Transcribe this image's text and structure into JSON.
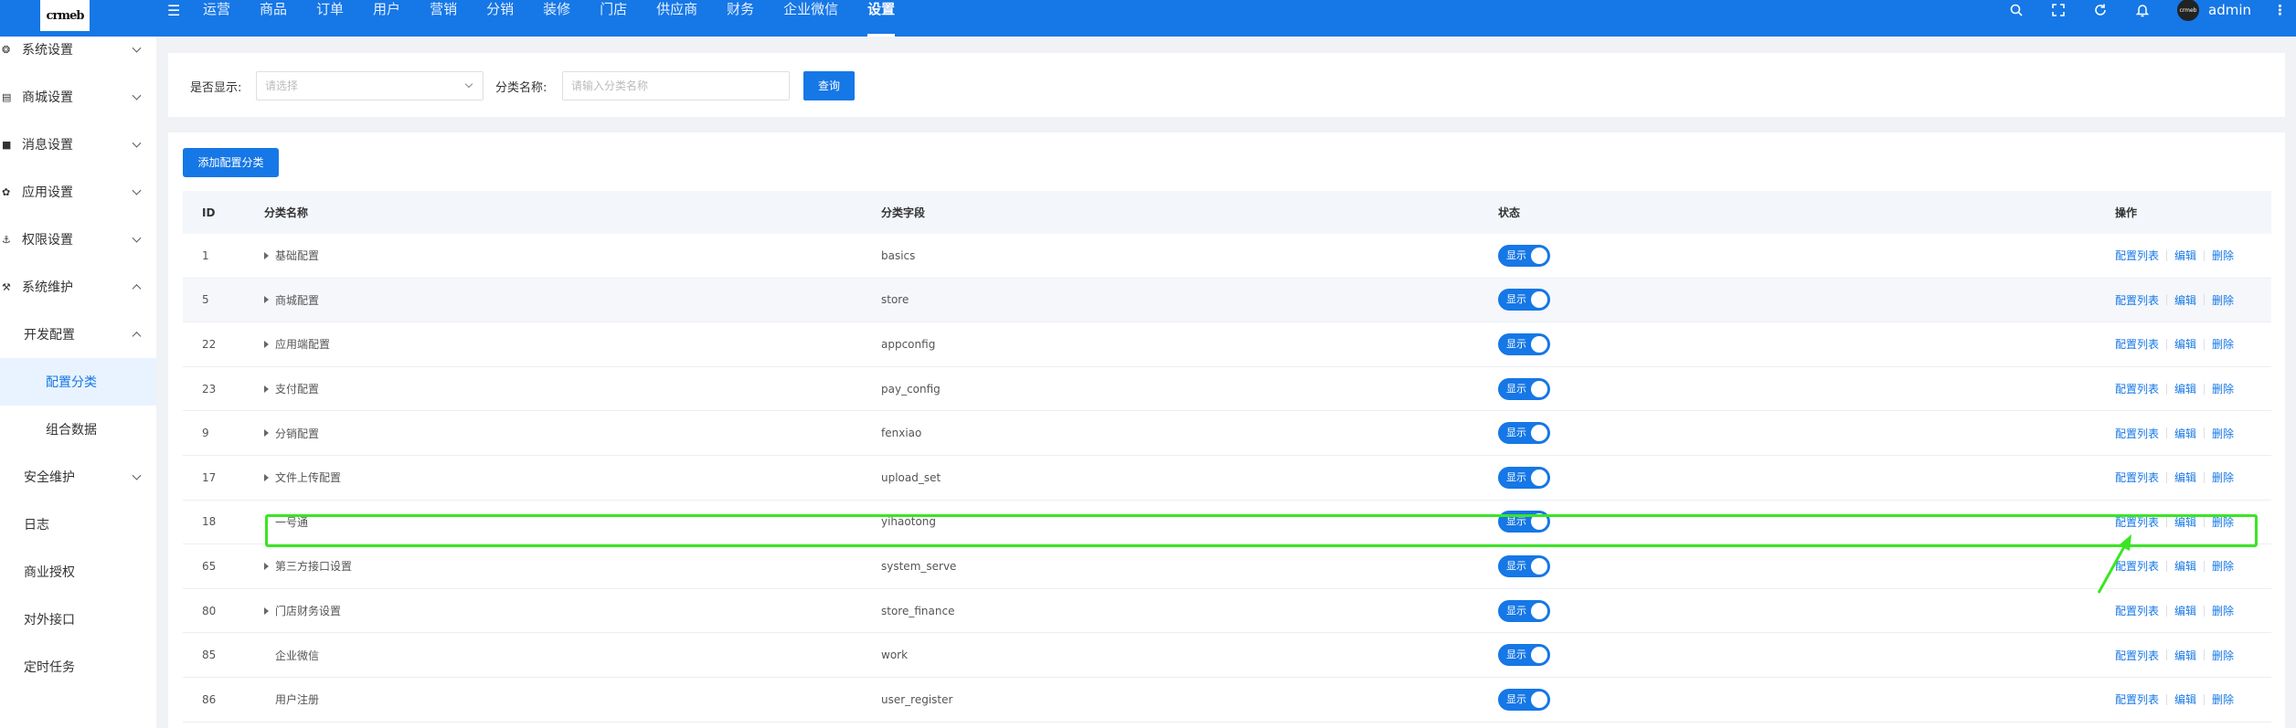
{
  "header": {
    "logo": "crmeb",
    "nav": [
      "运营",
      "商品",
      "订单",
      "用户",
      "营销",
      "分销",
      "装修",
      "门店",
      "供应商",
      "财务",
      "企业微信",
      "设置"
    ],
    "active_nav": "设置",
    "avatar_text": "crmeb",
    "username": "admin",
    "icons": [
      "search-icon",
      "fullscreen-icon",
      "refresh-icon",
      "bell-icon",
      "more-icon"
    ]
  },
  "sidebar": {
    "items": [
      {
        "label": "系统设置",
        "icon": "setting-icon",
        "expanded": false
      },
      {
        "label": "商城设置",
        "icon": "shop-icon",
        "expanded": false
      },
      {
        "label": "消息设置",
        "icon": "message-icon",
        "expanded": false
      },
      {
        "label": "应用设置",
        "icon": "app-icon",
        "expanded": false
      },
      {
        "label": "权限设置",
        "icon": "permission-icon",
        "expanded": false
      },
      {
        "label": "系统维护",
        "icon": "wrench-icon",
        "expanded": true
      },
      {
        "label": "开发配置",
        "expanded": true
      },
      {
        "label": "配置分类",
        "active": true
      },
      {
        "label": "组合数据"
      },
      {
        "label": "安全维护",
        "expanded": false
      },
      {
        "label": "日志"
      },
      {
        "label": "商业授权"
      },
      {
        "label": "对外接口"
      },
      {
        "label": "定时任务"
      }
    ]
  },
  "filter": {
    "show_label": "是否显示:",
    "show_placeholder": "请选择",
    "name_label": "分类名称:",
    "name_placeholder": "请输入分类名称",
    "query_button": "查询"
  },
  "toolbar": {
    "add_button": "添加配置分类"
  },
  "table": {
    "columns": [
      "ID",
      "分类名称",
      "分类字段",
      "状态",
      "操作"
    ],
    "rows": [
      {
        "id": "1",
        "name": "基础配置",
        "field": "basics",
        "status": "显示",
        "expandable": true
      },
      {
        "id": "5",
        "name": "商城配置",
        "field": "store",
        "status": "显示",
        "expandable": true
      },
      {
        "id": "22",
        "name": "应用端配置",
        "field": "appconfig",
        "status": "显示",
        "expandable": true
      },
      {
        "id": "23",
        "name": "支付配置",
        "field": "pay_config",
        "status": "显示",
        "expandable": true
      },
      {
        "id": "9",
        "name": "分销配置",
        "field": "fenxiao",
        "status": "显示",
        "expandable": true
      },
      {
        "id": "17",
        "name": "文件上传配置",
        "field": "upload_set",
        "status": "显示",
        "expandable": true
      },
      {
        "id": "18",
        "name": "一号通",
        "field": "yihaotong",
        "status": "显示",
        "expandable": false
      },
      {
        "id": "65",
        "name": "第三方接口设置",
        "field": "system_serve",
        "status": "显示",
        "expandable": true
      },
      {
        "id": "80",
        "name": "门店财务设置",
        "field": "store_finance",
        "status": "显示",
        "expandable": true
      },
      {
        "id": "85",
        "name": "企业微信",
        "field": "work",
        "status": "显示",
        "expandable": false
      },
      {
        "id": "86",
        "name": "用户注册",
        "field": "user_register",
        "status": "显示",
        "expandable": false
      }
    ],
    "operations": [
      "配置列表",
      "编辑",
      "删除"
    ]
  },
  "colors": {
    "primary": "#1677e6",
    "annotation": "#39e622"
  }
}
